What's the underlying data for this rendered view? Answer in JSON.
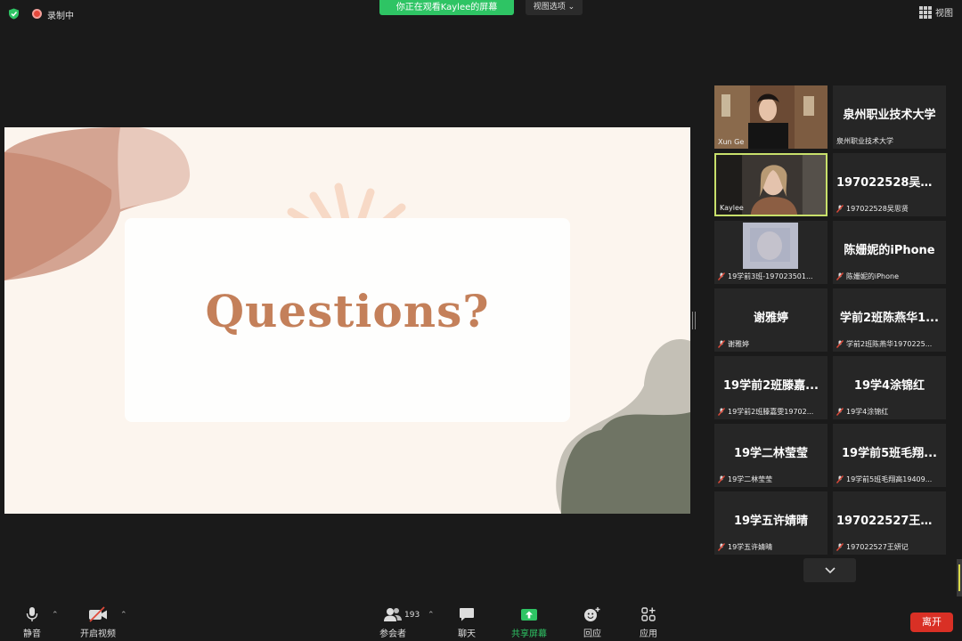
{
  "topbar": {
    "recording_label": "录制中",
    "share_banner": "你正在观看Kaylee的屏幕",
    "view_options": "视图选项 ⌄",
    "view_label": "视图"
  },
  "slide": {
    "title": "Questions?"
  },
  "gallery": {
    "tiles": [
      {
        "big": "",
        "label": "Xun Ge",
        "video": true
      },
      {
        "big": "泉州职业技术大学",
        "label": "泉州职业技术大学",
        "video": false
      },
      {
        "big": "",
        "label": "Kaylee",
        "video": true,
        "active": true
      },
      {
        "big": "197022528吴思贤",
        "label": "197022528吴思贤",
        "video": false,
        "muted": true
      },
      {
        "big": "",
        "label": "19学前3班-197023501...",
        "video": true,
        "muted": true
      },
      {
        "big": "陈姗妮的iPhone",
        "label": "陈姗妮的iPhone",
        "video": false,
        "muted": true
      },
      {
        "big": "谢雅婷",
        "label": "谢雅婷",
        "video": false,
        "muted": true
      },
      {
        "big": "学前2班陈燕华1...",
        "label": "学前2班陈燕华1970225...",
        "video": false,
        "muted": true
      },
      {
        "big": "19学前2班滕嘉...",
        "label": "19学前2班滕嘉雯19702...",
        "video": false,
        "muted": true
      },
      {
        "big": "19学4涂锦红",
        "label": "19学4涂锦红",
        "video": false,
        "muted": true
      },
      {
        "big": "19学二林莹莹",
        "label": "19学二林莹莹",
        "video": false,
        "muted": true
      },
      {
        "big": "19学前5班毛翔...",
        "label": "19学前5班毛翔高19409...",
        "video": false,
        "muted": true
      },
      {
        "big": "19学五许婧晴",
        "label": "19学五许婧晴",
        "video": false,
        "muted": true
      },
      {
        "big": "197022527王妍记",
        "label": "197022527王妍记",
        "video": false,
        "muted": true
      }
    ]
  },
  "toolbar": {
    "mute": "静音",
    "start_video": "开启视频",
    "participants": "参会者",
    "participants_count": "193",
    "chat": "聊天",
    "share_screen": "共享屏幕",
    "reactions": "回应",
    "apps": "应用",
    "leave": "离开"
  },
  "colors": {
    "share_green": "#2ec464",
    "active_border": "#c8e06b",
    "leave_red": "#d93025",
    "slide_title": "#c4805a"
  }
}
